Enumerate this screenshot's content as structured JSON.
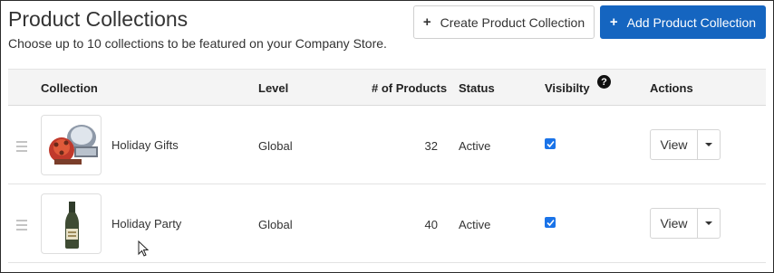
{
  "header": {
    "title": "Product Collections",
    "subtitle": "Choose up to 10 collections to be featured on your Company Store.",
    "create_button": "Create Product Collection",
    "add_button": "Add Product Collection",
    "plus_glyph": "+"
  },
  "table": {
    "columns": {
      "collection": "Collection",
      "level": "Level",
      "products": "# of Products",
      "status": "Status",
      "visibility": "Visibilty",
      "actions": "Actions"
    },
    "rows": [
      {
        "name": "Holiday Gifts",
        "level": "Global",
        "products": "32",
        "status": "Active",
        "visible": true,
        "action": "View"
      },
      {
        "name": "Holiday Party",
        "level": "Global",
        "products": "40",
        "status": "Active",
        "visible": true,
        "action": "View"
      }
    ]
  },
  "colors": {
    "primary": "#1565c0",
    "checkbox": "#1a73e8"
  },
  "icons": {
    "help": "question-circle-icon",
    "drag": "drag-handle-icon",
    "caret": "caret-down-icon",
    "check": "checkmark-icon"
  }
}
